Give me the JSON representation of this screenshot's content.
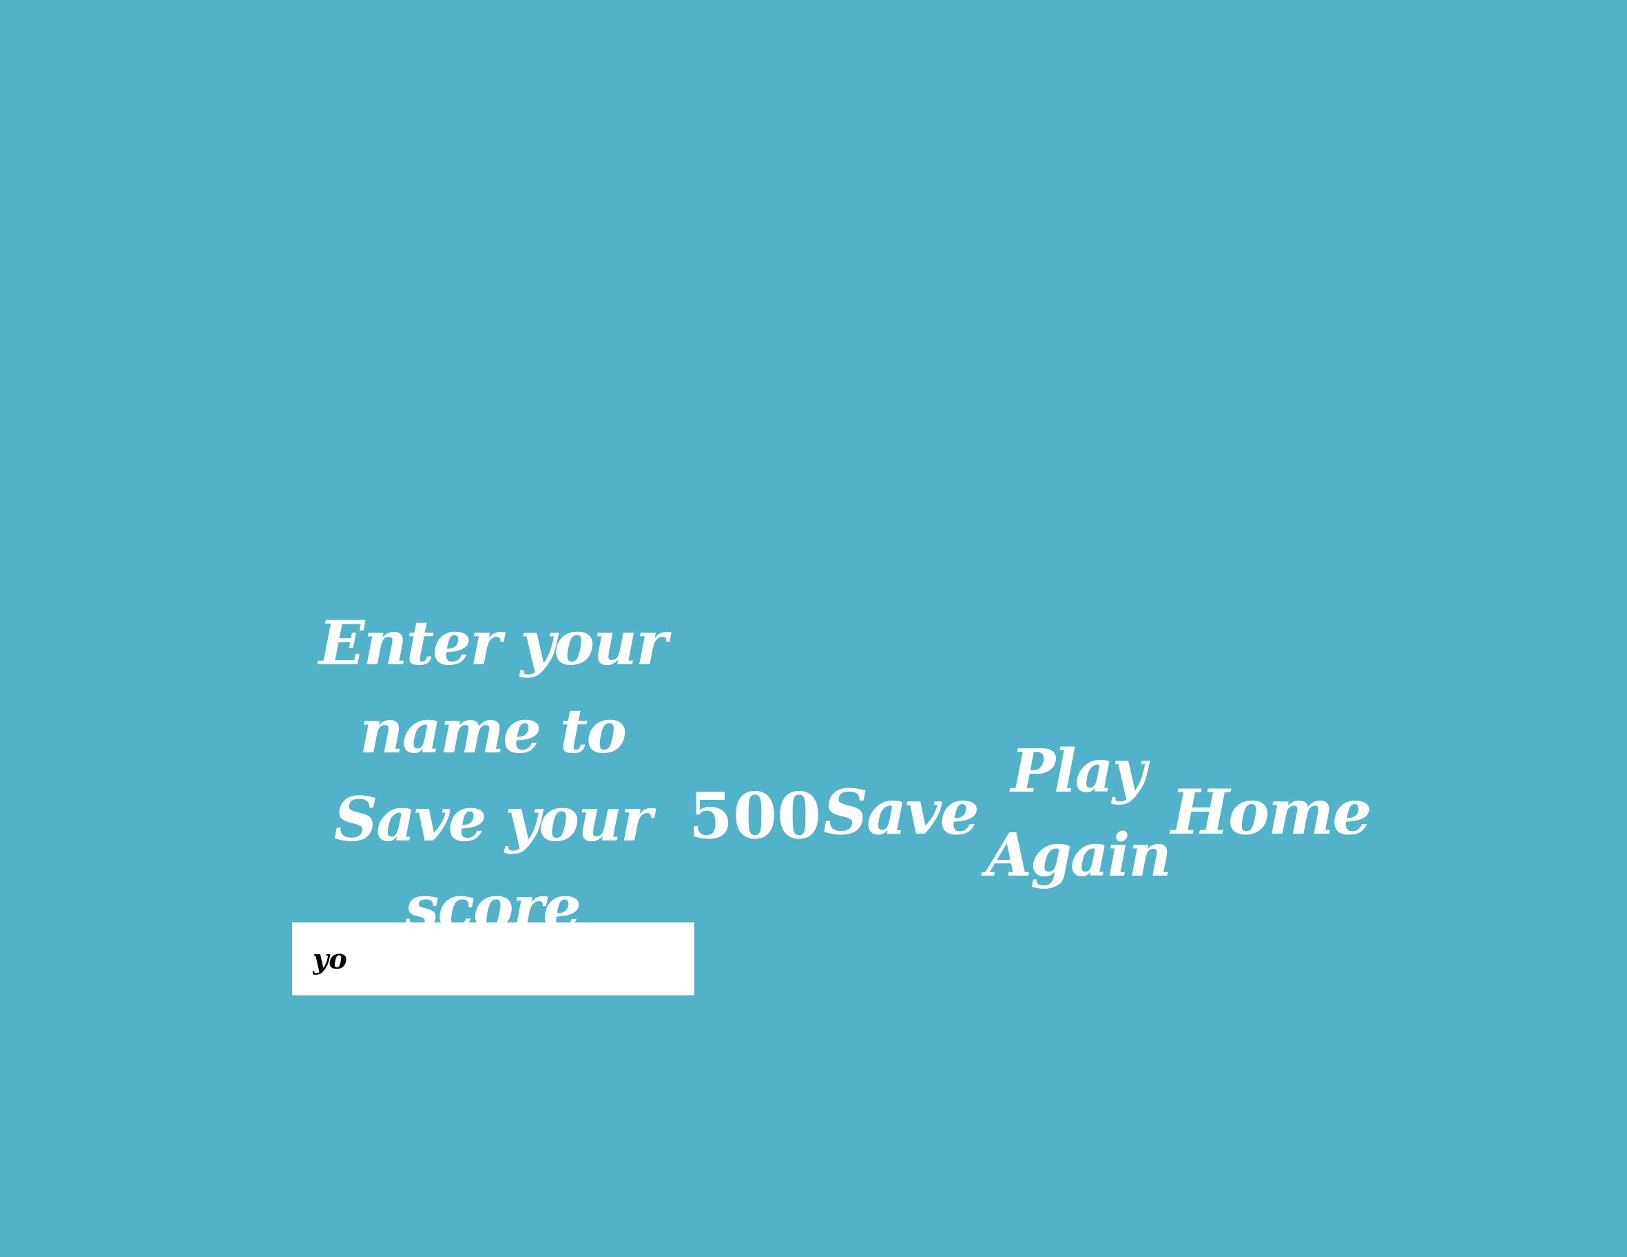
{
  "game": {
    "prompt": "Enter your name to Save your score",
    "score": "500",
    "save_label": "Save",
    "play_again_label": "Play Again",
    "home_label": "Home",
    "name_input_value": "yo"
  },
  "colors": {
    "background": "#52b2ca",
    "text": "#ffffff",
    "input_background": "#ffffff",
    "input_text": "#000000"
  }
}
